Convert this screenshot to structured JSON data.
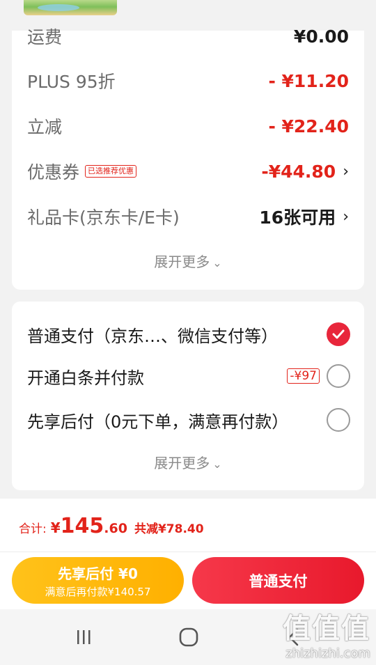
{
  "cost_card": {
    "rows": [
      {
        "label": "运费",
        "value": "¥0.00"
      },
      {
        "label": "PLUS 95折",
        "value": "- ¥11.20"
      },
      {
        "label": "立减",
        "value": "- ¥22.40"
      },
      {
        "label": "优惠券",
        "tag": "已选推荐优惠",
        "value": "-¥44.80"
      },
      {
        "label": "礼品卡(京东卡/E卡)",
        "value": "16张可用"
      }
    ],
    "expand_label": "展开更多"
  },
  "payment_card": {
    "options": [
      {
        "label": "普通支付（京东…、微信支付等）",
        "checked": true
      },
      {
        "label": "开通白条并付款",
        "tag": "-¥97",
        "checked": false
      },
      {
        "label": "先享后付（0元下单，满意再付款）",
        "checked": false
      }
    ],
    "expand_label": "展开更多"
  },
  "summary": {
    "total_label": "合计:",
    "currency": "¥",
    "total_int": "145",
    "total_dec": ".60",
    "saved": "共减¥78.40"
  },
  "actions": {
    "pay_later_line1": "先享后付 ¥0",
    "pay_later_line2": "满意后再付款¥140.57",
    "pay_now": "普通支付"
  },
  "watermark": {
    "line1": "值值值",
    "line2": "zhizhizhi.com"
  },
  "colors": {
    "accent_red": "#e2231a",
    "pay_button": "#f6384a",
    "pay_later_button": "#ffb000"
  }
}
